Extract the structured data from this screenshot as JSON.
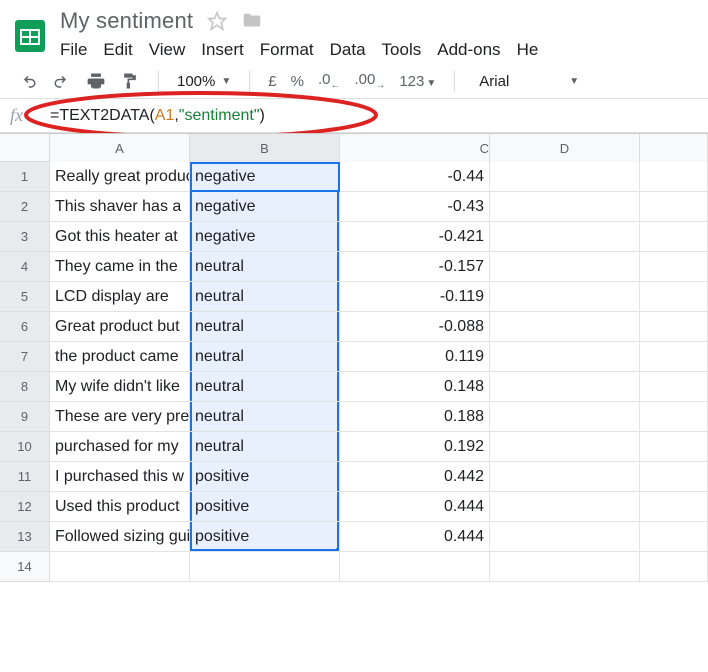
{
  "doc": {
    "title": "My sentiment"
  },
  "menus": {
    "file": "File",
    "edit": "Edit",
    "view": "View",
    "insert": "Insert",
    "format": "Format",
    "data": "Data",
    "tools": "Tools",
    "addons": "Add-ons",
    "help": "He"
  },
  "toolbar": {
    "zoom": "100%",
    "currency": "£",
    "percent": "%",
    "dec_dec": ".0",
    "dec_inc": ".00",
    "numfmt": "123",
    "font": "Arial"
  },
  "formula": {
    "prefix": "=",
    "func": "TEXT2DATA",
    "open": "(",
    "ref": "A1",
    "comma": ",",
    "str": "\"sentiment\"",
    "close": ")"
  },
  "columns": [
    "A",
    "B",
    "C",
    "D"
  ],
  "sheet": {
    "rows": [
      {
        "n": "1",
        "a": "Really great product for",
        "b": "negative",
        "c": "-0.44"
      },
      {
        "n": "2",
        "a": "This shaver has a",
        "b": "negative",
        "c": "-0.43"
      },
      {
        "n": "3",
        "a": "Got this heater at",
        "b": "negative",
        "c": "-0.421"
      },
      {
        "n": "4",
        "a": "They came in the",
        "b": "neutral",
        "c": "-0.157"
      },
      {
        "n": "5",
        "a": "LCD display are",
        "b": "neutral",
        "c": "-0.119"
      },
      {
        "n": "6",
        "a": "Great product but",
        "b": "neutral",
        "c": "-0.088"
      },
      {
        "n": "7",
        "a": "the product came",
        "b": "neutral",
        "c": "0.119"
      },
      {
        "n": "8",
        "a": "My wife didn't like",
        "b": "neutral",
        "c": "0.148"
      },
      {
        "n": "9",
        "a": "These are very pretty",
        "b": "neutral",
        "c": "0.188"
      },
      {
        "n": "10",
        "a": "purchased for my",
        "b": "neutral",
        "c": "0.192"
      },
      {
        "n": "11",
        "a": "I purchased this w",
        "b": "positive",
        "c": "0.442"
      },
      {
        "n": "12",
        "a": "Used this product",
        "b": "positive",
        "c": "0.444"
      },
      {
        "n": "13",
        "a": "Followed sizing guide",
        "b": "positive",
        "c": "0.444"
      },
      {
        "n": "14",
        "a": "",
        "b": "",
        "c": ""
      }
    ]
  }
}
